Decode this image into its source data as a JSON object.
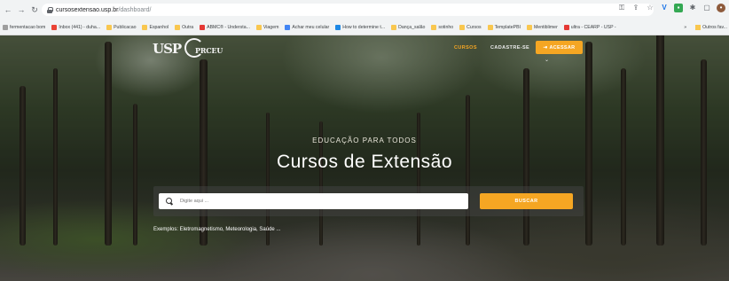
{
  "browser": {
    "nav_icons": [
      "back-icon",
      "forward-icon",
      "reload-icon"
    ],
    "url_host": "cursosextensao.usp.br",
    "url_path": "/dashboard/",
    "bookmarks": [
      {
        "label": "fermentacao bom",
        "icon": "bookmark-icon",
        "color": "#9e9e9e"
      },
      {
        "label": "Inbox (441) - duha...",
        "icon": "gmail-icon",
        "color": "#ea4335"
      },
      {
        "label": "Publicacao",
        "icon": "folder-icon",
        "color": "#f9c74f"
      },
      {
        "label": "Espanhol",
        "icon": "folder-icon",
        "color": "#f9c74f"
      },
      {
        "label": "Outra",
        "icon": "folder-icon",
        "color": "#f9c74f"
      },
      {
        "label": "ABMC® - Understa...",
        "icon": "youtube-icon",
        "color": "#e53935"
      },
      {
        "label": "Viagem",
        "icon": "folder-icon",
        "color": "#f9c74f"
      },
      {
        "label": "Achar meu celular",
        "icon": "google-icon",
        "color": "#4285f4"
      },
      {
        "label": "How to determine t...",
        "icon": "site-icon",
        "color": "#1e88e5"
      },
      {
        "label": "Dança_salão",
        "icon": "folder-icon",
        "color": "#f9c74f"
      },
      {
        "label": "sotinho",
        "icon": "folder-icon",
        "color": "#f9c74f"
      },
      {
        "label": "Cursos",
        "icon": "folder-icon",
        "color": "#f9c74f"
      },
      {
        "label": "TemplatePBI",
        "icon": "folder-icon",
        "color": "#f9c74f"
      },
      {
        "label": "Mentiblimer",
        "icon": "folder-icon",
        "color": "#f9c74f"
      },
      {
        "label": "ultra - CEARP - USP -",
        "icon": "youtube-icon",
        "color": "#e53935"
      }
    ],
    "bookmarks_more": "»",
    "other_bookmarks": "Outros fav..."
  },
  "nav": {
    "logo_usp": "USP",
    "logo_preceu": "PRCEU",
    "links": [
      {
        "label": "CURSOS",
        "active": true
      },
      {
        "label": "CADASTRE-SE",
        "active": false
      }
    ],
    "access_button": "ACESSAR"
  },
  "hero": {
    "kicker": "EDUCAÇÃO PARA TODOS",
    "title": "Cursos de Extensão",
    "search_placeholder": "Digite aqui ...",
    "search_button": "BUSCAR",
    "examples": "Exemplos: Eletromagnetismo, Meteorologia, Saúde ..."
  },
  "colors": {
    "accent": "#f5a623"
  }
}
